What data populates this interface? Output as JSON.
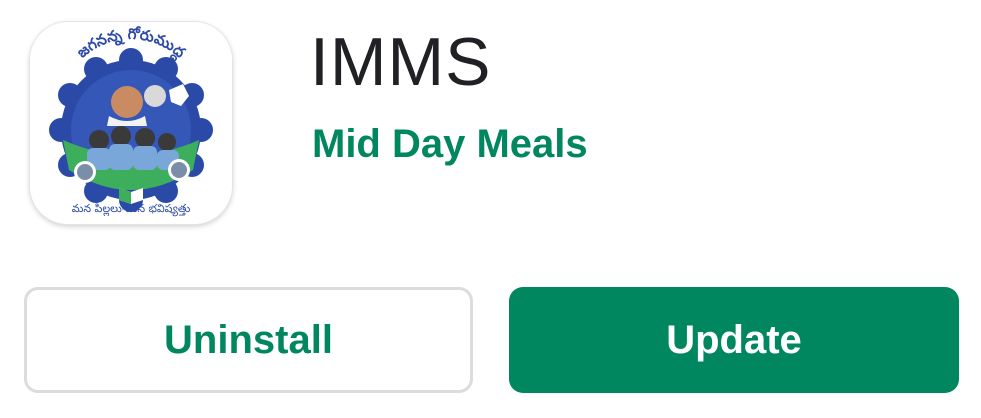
{
  "app": {
    "title": "IMMS",
    "developer": "Mid Day Meals",
    "icon": "imms-logo-icon",
    "icon_banner_text": "జగనన్న గోరుముద్ద",
    "icon_footer_text": "మన పిల్లలు-మన భవిష్యత్తు"
  },
  "actions": {
    "uninstall_label": "Uninstall",
    "update_label": "Update"
  },
  "colors": {
    "accent": "#01875f",
    "title_text": "#202124",
    "button_border": "#dadce0"
  }
}
